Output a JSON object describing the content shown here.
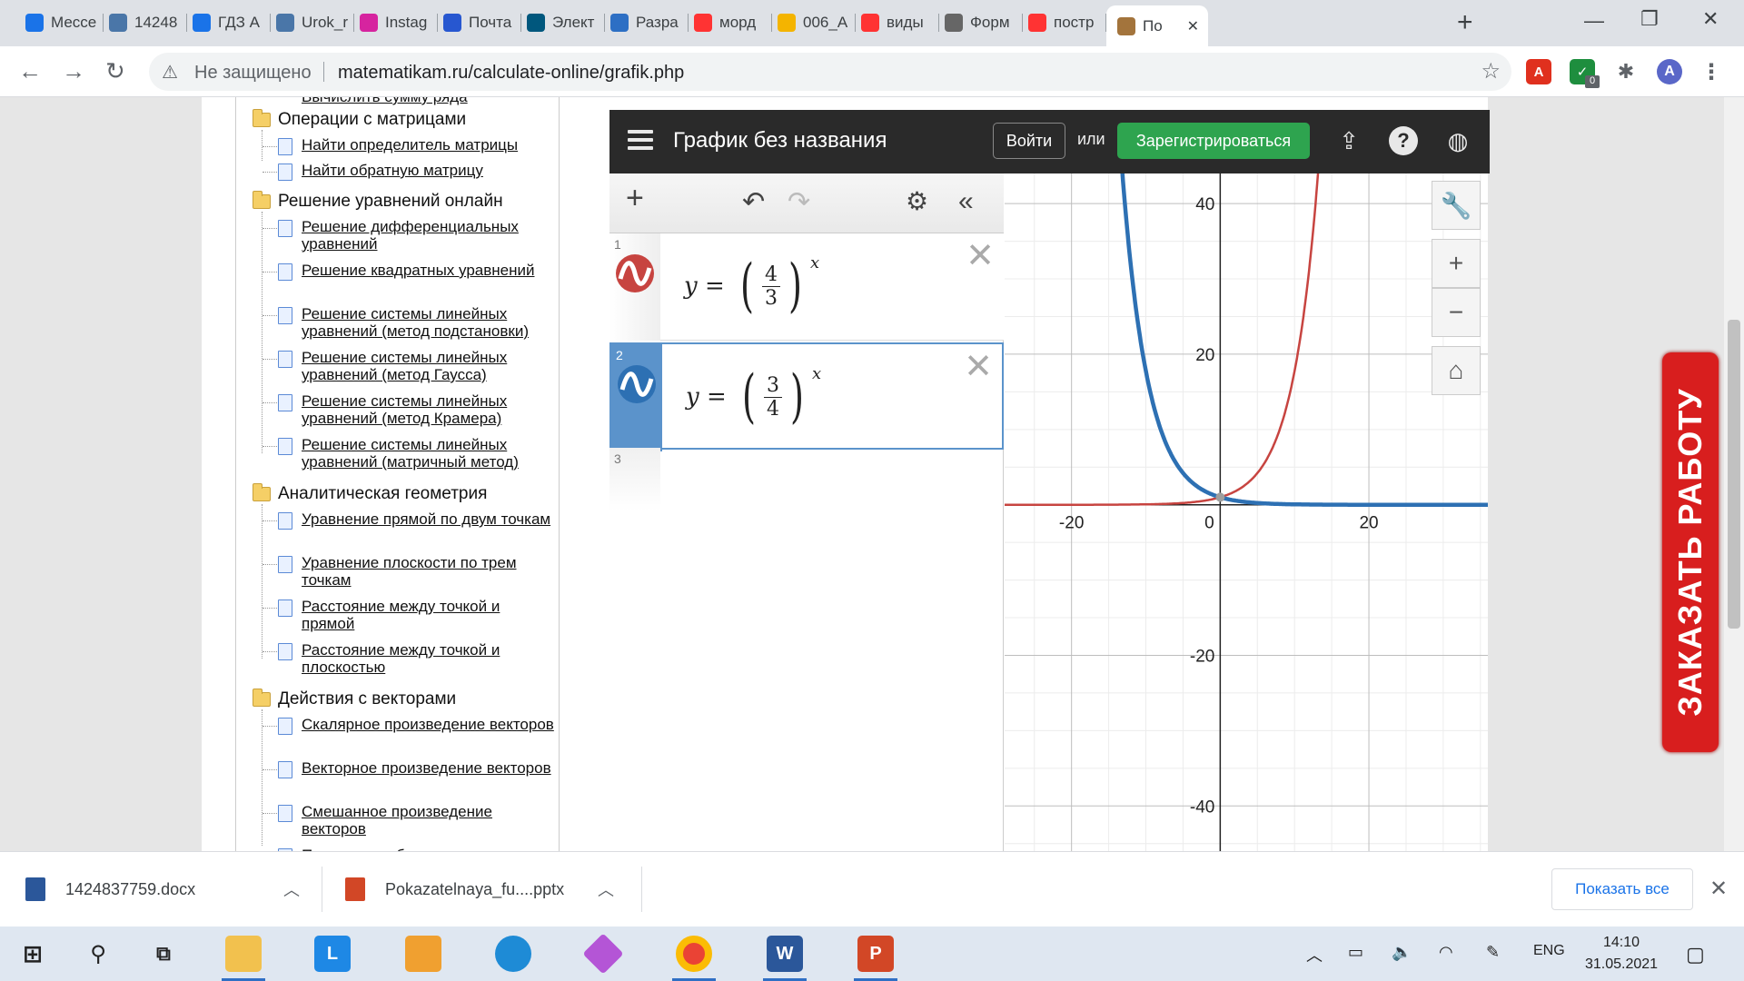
{
  "browser": {
    "tabs": [
      {
        "label": "Мессе",
        "icon": "messenger-icon",
        "color": "#1a73e8"
      },
      {
        "label": "14248",
        "icon": "vk-icon",
        "color": "#4a76a8"
      },
      {
        "label": "ГДЗ А",
        "icon": "home-icon",
        "color": "#1a73e8"
      },
      {
        "label": "Urok_r",
        "icon": "vk-icon",
        "color": "#4a76a8"
      },
      {
        "label": "Instag",
        "icon": "instagram-icon",
        "color": "#d6249f"
      },
      {
        "label": "Почта",
        "icon": "mail-icon",
        "color": "#2757d0"
      },
      {
        "label": "Элект",
        "icon": "doc-icon",
        "color": "#00577d"
      },
      {
        "label": "Разра",
        "icon": "person-icon",
        "color": "#2d6fc4"
      },
      {
        "label": "морд",
        "icon": "yandex-icon",
        "color": "#f33"
      },
      {
        "label": "006_А",
        "icon": "drive-icon",
        "color": "#f4b400"
      },
      {
        "label": "виды",
        "icon": "yandex-icon",
        "color": "#f33"
      },
      {
        "label": "Форм",
        "icon": "globe-icon",
        "color": "#666"
      },
      {
        "label": "постр",
        "icon": "yandex-icon",
        "color": "#f33"
      },
      {
        "label": "По",
        "icon": "user-icon",
        "color": "#a3743c",
        "active": true
      }
    ],
    "security_label": "Не защищено",
    "url": "matematikam.ru/calculate-online/grafik.php",
    "profile_initial": "A",
    "ext_badge": "0"
  },
  "sidebar": {
    "cut_top": "Вычислить сумму ряда",
    "categories": [
      {
        "title": "Операции с матрицами",
        "items": [
          "Найти определитель матрицы",
          "Найти обратную матрицу"
        ]
      },
      {
        "title": "Решение уравнений онлайн",
        "items": [
          "Решение дифференциальных уравнений",
          "Решение квадратных уравнений",
          "Решение системы линейных уравнений (метод подстановки)",
          "Решение системы линейных уравнений (метод Гаусса)",
          "Решение системы линейных уравнений (метод Крамера)",
          "Решение системы линейных уравнений (матричный метод)"
        ]
      },
      {
        "title": "Аналитическая геометрия",
        "items": [
          "Уравнение прямой по двум точкам",
          "Уравнение плоскости по трем точкам",
          "Расстояние между точкой и прямой",
          "Расстояние между точкой и плоскостью"
        ]
      },
      {
        "title": "Действия с векторами",
        "items": [
          "Скалярное произведение векторов",
          "Векторное произведение векторов",
          "Смешанное произведение векторов",
          "Проверить, образуют ли"
        ]
      }
    ]
  },
  "desmos": {
    "title": "График без названия",
    "login": "Войти",
    "or": "или",
    "register": "Зарегистрироваться",
    "expressions": [
      {
        "index": "1",
        "lhs": "y",
        "eq": "=",
        "num": "4",
        "den": "3",
        "exp": "x",
        "color": "#c74440"
      },
      {
        "index": "2",
        "lhs": "y",
        "eq": "=",
        "num": "3",
        "den": "4",
        "exp": "x",
        "color": "#2d70b3"
      }
    ],
    "empty_index": "3"
  },
  "chart_data": {
    "type": "line",
    "xlim": [
      -29,
      36
    ],
    "ylim": [
      -46,
      44
    ],
    "x_ticks": [
      "-20",
      "0",
      "20"
    ],
    "y_ticks": [
      "40",
      "20",
      "-20",
      "-40"
    ],
    "grid": true,
    "series": [
      {
        "expression": "y=(4/3)^x",
        "base": 1.3333,
        "color": "#c74440"
      },
      {
        "expression": "y=(3/4)^x",
        "base": 0.75,
        "color": "#2d70b3"
      }
    ]
  },
  "order_banner": "ЗАКАЗАТЬ РАБОТУ",
  "downloads": {
    "files": [
      "1424837759.docx",
      "Pokazatelnaya_fu....pptx"
    ],
    "show_all": "Показать все"
  },
  "taskbar": {
    "lang": "ENG",
    "time": "14:10",
    "date": "31.05.2021"
  }
}
